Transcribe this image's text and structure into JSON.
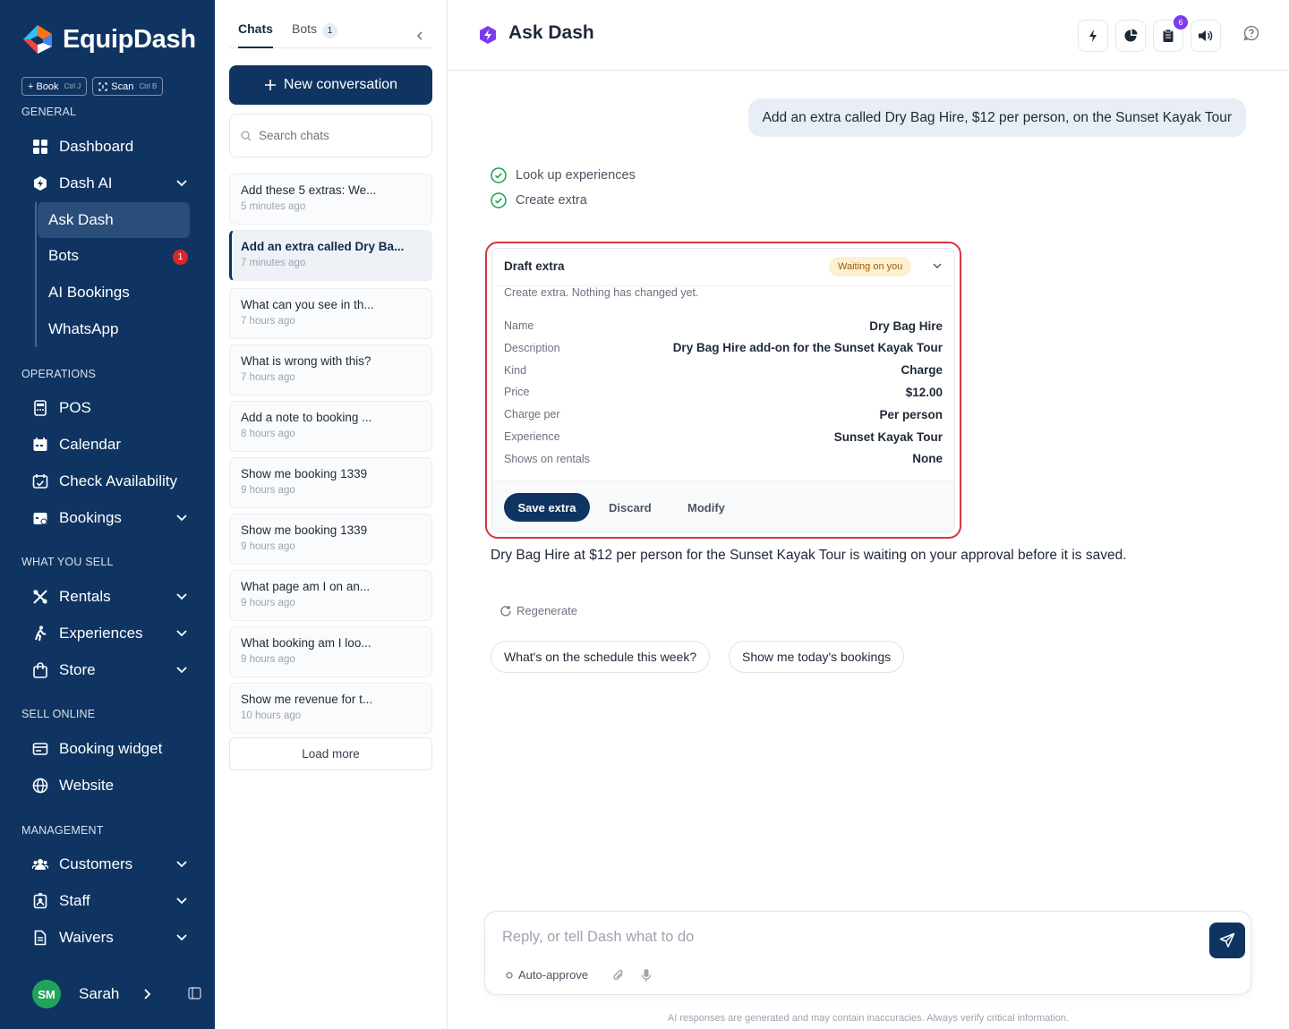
{
  "sidebar": {
    "brand": "EquipDash",
    "quick": [
      {
        "label": "+ Book",
        "kbd": "Ctrl J"
      },
      {
        "label": "Scan",
        "kbd": "Ctrl B"
      }
    ],
    "sections": {
      "general": "GENERAL",
      "operations": "OPERATIONS",
      "what_you_sell": "WHAT YOU SELL",
      "sell_online": "SELL ONLINE",
      "management": "MANAGEMENT"
    },
    "items": {
      "dashboard": "Dashboard",
      "dash_ai": "Dash AI",
      "ask_dash": "Ask Dash",
      "bots": "Bots",
      "bots_badge": "1",
      "ai_bookings": "AI Bookings",
      "whatsapp": "WhatsApp",
      "pos": "POS",
      "calendar": "Calendar",
      "check_availability": "Check Availability",
      "bookings": "Bookings",
      "rentals": "Rentals",
      "experiences": "Experiences",
      "store": "Store",
      "booking_widget": "Booking widget",
      "website": "Website",
      "customers": "Customers",
      "staff": "Staff",
      "waivers": "Waivers"
    },
    "user": {
      "initials": "SM",
      "name": "Sarah"
    }
  },
  "chatlist": {
    "tabs": {
      "chats": "Chats",
      "bots": "Bots",
      "bots_count": "1"
    },
    "new_conversation": "New conversation",
    "search_placeholder": "Search chats",
    "items": [
      {
        "title": "Add these 5 extras: We...",
        "time": "5 minutes ago"
      },
      {
        "title": "Add an extra called Dry Ba...",
        "time": "7 minutes ago"
      },
      {
        "title": "What can you see in th...",
        "time": "7 hours ago"
      },
      {
        "title": "What is wrong with this?",
        "time": "7 hours ago"
      },
      {
        "title": "Add a note to booking ...",
        "time": "8 hours ago"
      },
      {
        "title": "Show me booking 1339",
        "time": "9 hours ago"
      },
      {
        "title": "Show me booking 1339",
        "time": "9 hours ago"
      },
      {
        "title": "What page am I on an...",
        "time": "9 hours ago"
      },
      {
        "title": "What booking am I loo...",
        "time": "9 hours ago"
      },
      {
        "title": "Show me revenue for t...",
        "time": "10 hours ago"
      }
    ],
    "load_more": "Load more"
  },
  "main": {
    "title": "Ask Dash",
    "notifications_count": "6",
    "user_message": "Add an extra called Dry Bag Hire, $12 per person, on the Sunset Kayak Tour",
    "steps": [
      "Look up experiences",
      "Create extra"
    ],
    "draft": {
      "title": "Draft extra",
      "status": "Waiting on you",
      "subtitle": "Create extra. Nothing has changed yet.",
      "fields": [
        {
          "key": "Name",
          "value": "Dry Bag Hire"
        },
        {
          "key": "Description",
          "value": "Dry Bag Hire add-on for the Sunset Kayak Tour"
        },
        {
          "key": "Kind",
          "value": "Charge"
        },
        {
          "key": "Price",
          "value": "$12.00"
        },
        {
          "key": "Charge per",
          "value": "Per person"
        },
        {
          "key": "Experience",
          "value": "Sunset Kayak Tour"
        },
        {
          "key": "Shows on rentals",
          "value": "None"
        }
      ],
      "save": "Save extra",
      "discard": "Discard",
      "modify": "Modify"
    },
    "answer": "Dry Bag Hire at $12 per person for the Sunset Kayak Tour is waiting on your approval before it is saved.",
    "regenerate": "Regenerate",
    "suggestions": [
      "What's on the schedule this week?",
      "Show me today's bookings"
    ],
    "composer": {
      "placeholder": "Reply, or tell Dash what to do",
      "auto_approve": "Auto-approve"
    },
    "disclaimer": "AI responses are generated and may contain inaccuracies. Always verify critical information."
  }
}
